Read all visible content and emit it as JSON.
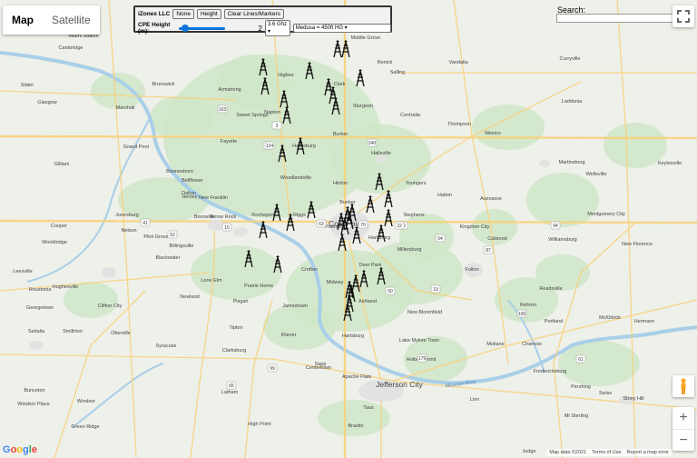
{
  "map_type": {
    "map_label": "Map",
    "satellite_label": "Satellite"
  },
  "panel": {
    "company_label": "iZonex LLC",
    "none_label": "None",
    "height_label": "Height",
    "clear_label": "Clear Lines/Markers",
    "cpe_label": "CPE Height (m):",
    "slider_fraction": 0.05,
    "slider_value": "2",
    "freq_value": "3.6 Ghz",
    "sector_value": "Medusa = 450ft HG"
  },
  "search": {
    "label": "Search:",
    "value": ""
  },
  "controls": {
    "fullscreen_icon": "fullscreen-icon",
    "zoom_in": "+",
    "zoom_out": "−",
    "pegman_icon": "pegman-icon"
  },
  "google_logo": "Google",
  "footer": {
    "map_data": "Map data ©2021",
    "terms": "Terms of Use",
    "report": "Report a map error"
  },
  "colors": {
    "land": "#eef0ea",
    "green": "#cfe6c8",
    "water": "#a9cfe8",
    "road": "#f7d27c",
    "tower": "#111111"
  },
  "places": [
    {
      "name": "Middle Grove"
    },
    {
      "name": "Renick"
    },
    {
      "name": "Salling"
    },
    {
      "name": "Vandalia"
    },
    {
      "name": "Curryville"
    },
    {
      "name": "Cambridge"
    },
    {
      "name": "Slater"
    },
    {
      "name": "Glasgow"
    },
    {
      "name": "Armstrong"
    },
    {
      "name": "Higbee"
    },
    {
      "name": "Clark"
    },
    {
      "name": "Sturgeon"
    },
    {
      "name": "Centralia"
    },
    {
      "name": "Thompson"
    },
    {
      "name": "Mexico"
    },
    {
      "name": "Laddonia"
    },
    {
      "name": "Fayette"
    },
    {
      "name": "Harrisburg"
    },
    {
      "name": "Hallsville"
    },
    {
      "name": "Boonesboro"
    },
    {
      "name": "Woodlandville"
    },
    {
      "name": "Hinton"
    },
    {
      "name": "Youngers"
    },
    {
      "name": "Hatton"
    },
    {
      "name": "Auxvasse"
    },
    {
      "name": "Martinsburg"
    },
    {
      "name": "Wellsville"
    },
    {
      "name": "New Franklin"
    },
    {
      "name": "Boonville"
    },
    {
      "name": "Rocheport"
    },
    {
      "name": "Columbia"
    },
    {
      "name": "Stephens"
    },
    {
      "name": "Kingdom City"
    },
    {
      "name": "Calwood"
    },
    {
      "name": "Williamsburg"
    },
    {
      "name": "Montgomery City"
    },
    {
      "name": "New Florence"
    },
    {
      "name": "Jonesburg"
    },
    {
      "name": "Blackwater"
    },
    {
      "name": "Pilot Grove"
    },
    {
      "name": "Billingsville"
    },
    {
      "name": "Wooldridge"
    },
    {
      "name": "Millersburg"
    },
    {
      "name": "Fulton"
    },
    {
      "name": "Readsville"
    },
    {
      "name": "Lone Elm"
    },
    {
      "name": "Prairie Home"
    },
    {
      "name": "Deer Park"
    },
    {
      "name": "Pisgah"
    },
    {
      "name": "Jamestown"
    },
    {
      "name": "Ashland"
    },
    {
      "name": "New Bloomfield"
    },
    {
      "name": "Reform"
    },
    {
      "name": "Portland"
    },
    {
      "name": "McKittrick"
    },
    {
      "name": "Hermann"
    },
    {
      "name": "Kliever"
    },
    {
      "name": "Hartsburg"
    },
    {
      "name": "Lake Mykee Town"
    },
    {
      "name": "Holts Summit"
    },
    {
      "name": "Mokane"
    },
    {
      "name": "Chamois"
    },
    {
      "name": "Clarksburg"
    },
    {
      "name": "Centertown"
    },
    {
      "name": "Apache Flats"
    },
    {
      "name": "Jefferson City"
    },
    {
      "name": "Fredericksburg"
    },
    {
      "name": "Latham"
    },
    {
      "name": "Taos"
    },
    {
      "name": "High Point"
    },
    {
      "name": "Brazito"
    },
    {
      "name": "Linn"
    },
    {
      "name": "Pershing"
    },
    {
      "name": "Swiss"
    },
    {
      "name": "Stony Hill"
    },
    {
      "name": "Mt Sterling"
    },
    {
      "name": "Judge"
    },
    {
      "name": "Syracuse"
    },
    {
      "name": "Tipton"
    },
    {
      "name": "Otterville"
    },
    {
      "name": "Smithton"
    },
    {
      "name": "Sedalia"
    },
    {
      "name": "Georgetown"
    },
    {
      "name": "Clifton City"
    },
    {
      "name": "Houstonia"
    },
    {
      "name": "Hughesville"
    },
    {
      "name": "Newland"
    },
    {
      "name": "Bunceton"
    },
    {
      "name": "Windsor Place"
    },
    {
      "name": "Windsor"
    },
    {
      "name": "Green Ridge"
    },
    {
      "name": "Leesville"
    },
    {
      "name": "Marshall"
    },
    {
      "name": "Gilliam"
    },
    {
      "name": "Malta Bend"
    },
    {
      "name": "Miami Station"
    },
    {
      "name": "Brunswick"
    },
    {
      "name": "Grand Pont"
    },
    {
      "name": "Keytesville"
    },
    {
      "name": "Dalton"
    },
    {
      "name": "Bellflower"
    },
    {
      "name": "Arrow Rock"
    },
    {
      "name": "Cooper"
    },
    {
      "name": "Nelson"
    },
    {
      "name": "Sweet Springs"
    },
    {
      "name": "Napton"
    },
    {
      "name": "Burton"
    },
    {
      "name": "Bunker"
    },
    {
      "name": "Riggs"
    },
    {
      "name": "Prathersville"
    },
    {
      "name": "Midway"
    },
    {
      "name": "Hartsburg"
    },
    {
      "name": "Sapp"
    },
    {
      "name": "Henley"
    },
    {
      "name": "Crofton"
    },
    {
      "name": "Missouri River"
    },
    {
      "name": "Missouri River"
    },
    {
      "name": "Missouri River"
    }
  ],
  "roads": [
    "24",
    "3",
    "124",
    "240",
    "40",
    "70",
    "63",
    "5",
    "54",
    "94",
    "87",
    "19",
    "50",
    "179",
    "100",
    "65",
    "41",
    "22",
    "163",
    "15",
    "52",
    "99",
    "61"
  ]
}
